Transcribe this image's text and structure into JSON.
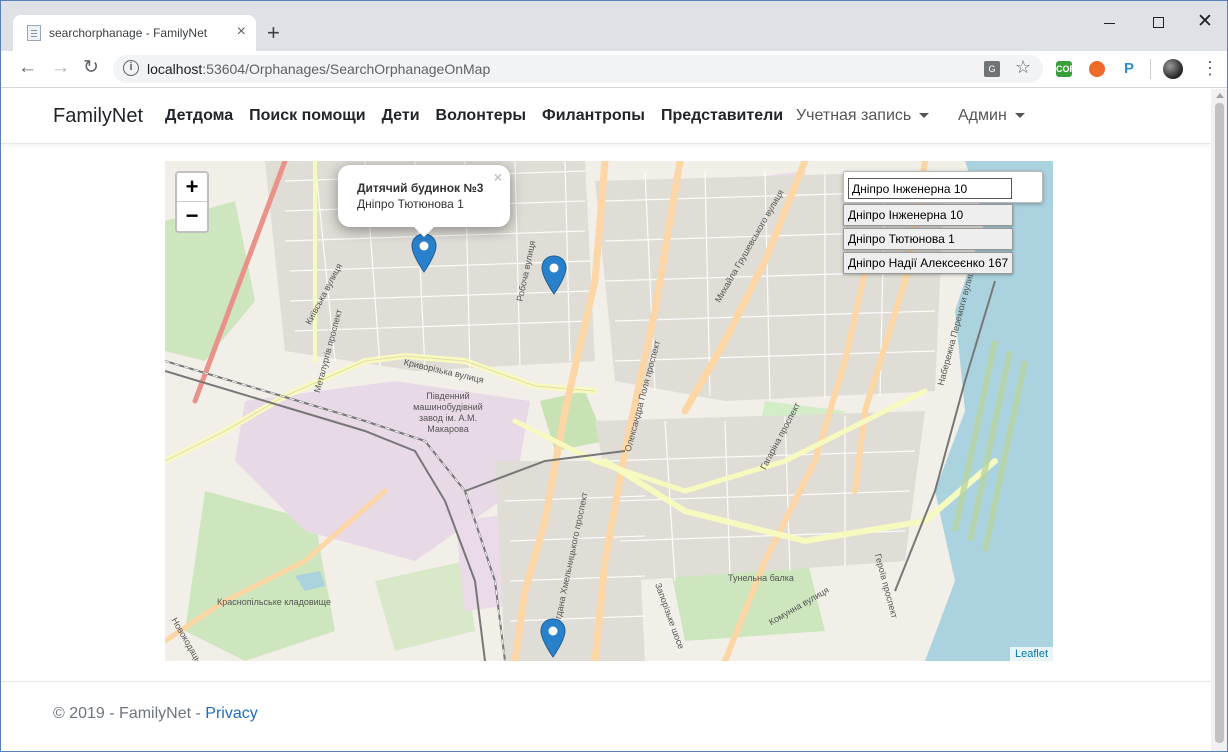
{
  "browser": {
    "tab_title": "searchorphanage - FamilyNet",
    "tab_close": "×",
    "new_tab": "+",
    "url_host": "localhost",
    "url_rest": ":53604/Orphanages/SearchOrphanageOnMap",
    "extensions": [
      {
        "name": "cors-extension-icon",
        "label": "CORS",
        "color": "#3c9d3c"
      },
      {
        "name": "orange-extension-icon",
        "label": "",
        "color": "#f06a28"
      },
      {
        "name": "p-extension-icon",
        "label": "P",
        "color": "#2d8ed8"
      }
    ]
  },
  "navbar": {
    "brand": "FamilyNet",
    "links": [
      "Детдома",
      "Поиск помощи",
      "Дети",
      "Волонтеры",
      "Филантропы",
      "Представители"
    ],
    "account_dropdown": "Учетная запись",
    "admin_dropdown": "Админ"
  },
  "map": {
    "zoom_in": "+",
    "zoom_out": "−",
    "popup": {
      "title": "Дитячий будинок №3",
      "address": "Дніпро Тютюнова 1",
      "close": "×"
    },
    "search_value": "Дніпро Інженерна 10",
    "suggestions": [
      "Дніпро Інженерна 10",
      "Дніпро Тютюнова 1",
      "Дніпро Надії Алексеєнко 167"
    ],
    "attribution": "Leaflet",
    "marker_color": "#2a81cb",
    "labels": [
      "Київська вулиця",
      "Металургів проспект",
      "Робоча вулиця",
      "Олександра Поля проспект",
      "Михайла Грушевського вулиця",
      "Криворізька вулиця",
      "Південний машинобудівний завод ім. А.М. Макарова",
      "Тунельна балка",
      "Краснопільське кладовище",
      "Набережна Перемоги вулиця",
      "Гагаріна проспект",
      "Богдана Хмельницького проспект",
      "Запорізьке шосе",
      "Комунна вулиця",
      "Героїв проспект",
      "Новокодацька"
    ]
  },
  "footer": {
    "copyright": "© 2019 - FamilyNet - ",
    "privacy": "Privacy"
  }
}
